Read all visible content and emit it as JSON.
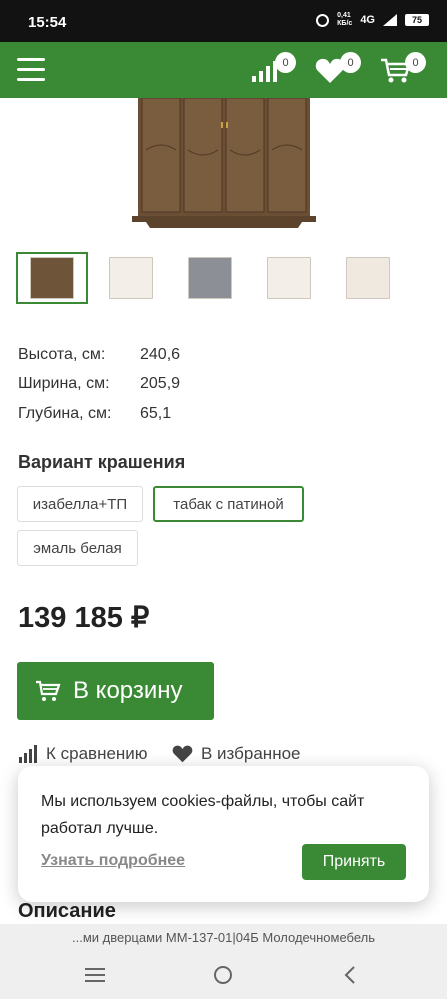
{
  "status_bar": {
    "time": "15:54",
    "net_speed_value": "0,41",
    "net_speed_unit": "КБ/с",
    "network": "4G",
    "battery": "75"
  },
  "header": {
    "compare_count": "0",
    "favorites_count": "0",
    "cart_count": "0",
    "brand_color": "#3a8a35"
  },
  "thumbnails": [
    {
      "color": "#6e5438",
      "active": true
    },
    {
      "color": "#f3efe8",
      "active": false
    },
    {
      "color": "#8c9096",
      "active": false
    },
    {
      "color": "#f3efe8",
      "active": false
    },
    {
      "color": "#efe9e0",
      "active": false
    }
  ],
  "specs": [
    {
      "label": "Высота, см:",
      "value": "240,6"
    },
    {
      "label": "Ширина, см:",
      "value": "205,9"
    },
    {
      "label": "Глубина, см:",
      "value": "65,1"
    }
  ],
  "variant": {
    "title": "Вариант крашения",
    "options": [
      {
        "label": "изабелла+ТП",
        "selected": false
      },
      {
        "label": "табак с патиной",
        "selected": true
      },
      {
        "label": "эмаль белая",
        "selected": false
      }
    ]
  },
  "price": "139 185 ₽",
  "cart_button": "В корзину",
  "actions": {
    "compare": "К сравнению",
    "favorite": "В избранное"
  },
  "description_title": "Описание",
  "url_snippet": "...ми дверцами ММ-137-01|04Б Молодечномебель",
  "cookie": {
    "message": "Мы используем cookies-файлы, чтобы сайт работал лучше.",
    "learn_more": "Узнать подробнее",
    "accept": "Принять"
  }
}
